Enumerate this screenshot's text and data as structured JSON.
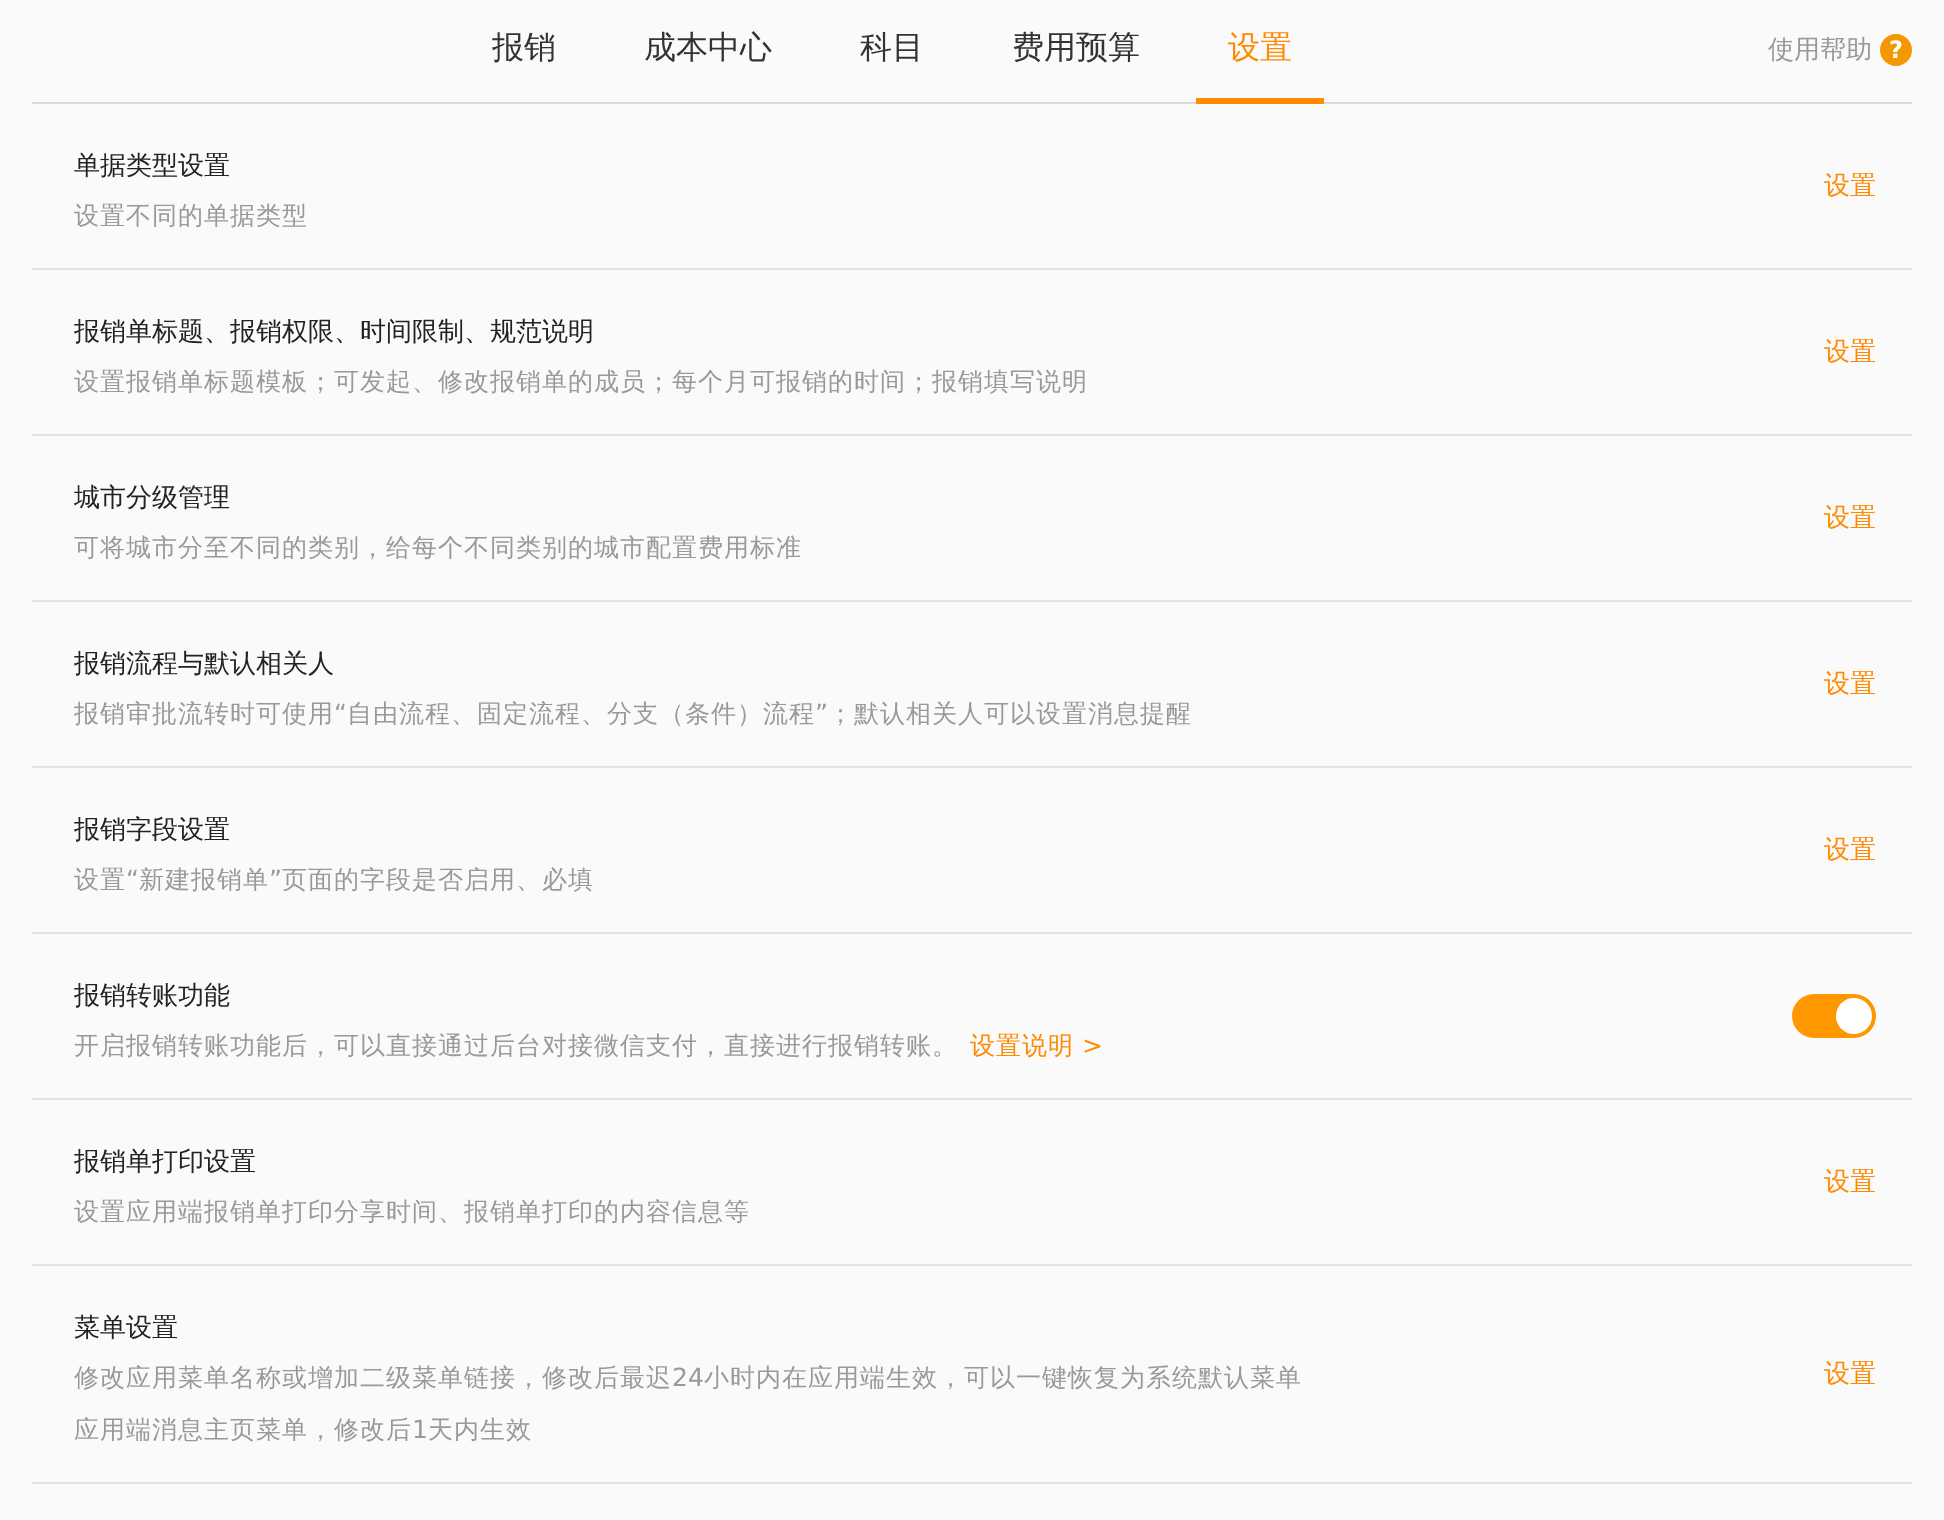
{
  "tabs": [
    {
      "label": "报销",
      "selected": false
    },
    {
      "label": "成本中心",
      "selected": false
    },
    {
      "label": "科目",
      "selected": false
    },
    {
      "label": "费用预算",
      "selected": false
    },
    {
      "label": "设置",
      "selected": true
    }
  ],
  "help": {
    "label": "使用帮助",
    "icon": "?"
  },
  "settings": [
    {
      "kind": "action",
      "title": "单据类型设置",
      "lines": [
        "设置不同的单据类型"
      ],
      "action": "设置"
    },
    {
      "kind": "action",
      "title": "报销单标题、报销权限、时间限制、规范说明",
      "lines": [
        "设置报销单标题模板；可发起、修改报销单的成员；每个月可报销的时间；报销填写说明"
      ],
      "action": "设置"
    },
    {
      "kind": "action",
      "title": "城市分级管理",
      "lines": [
        "可将城市分至不同的类别，给每个不同类别的城市配置费用标准"
      ],
      "action": "设置"
    },
    {
      "kind": "action",
      "title": "报销流程与默认相关人",
      "lines": [
        "报销审批流转时可使用“自由流程、固定流程、分支（条件）流程”；默认相关人可以设置消息提醒"
      ],
      "action": "设置"
    },
    {
      "kind": "action",
      "title": "报销字段设置",
      "lines": [
        "设置“新建报销单”页面的字段是否启用、必填"
      ],
      "action": "设置"
    },
    {
      "kind": "toggle",
      "title": "报销转账功能",
      "lines": [
        "开启报销转账功能后，可以直接通过后台对接微信支付，直接进行报销转账。"
      ],
      "link": "设置说明 >",
      "on": true
    },
    {
      "kind": "action",
      "title": "报销单打印设置",
      "lines": [
        "设置应用端报销单打印分享时间、报销单打印的内容信息等"
      ],
      "action": "设置"
    },
    {
      "kind": "action",
      "title": "菜单设置",
      "lines": [
        "修改应用菜单名称或增加二级菜单链接，修改后最迟24小时内在应用端生效，可以一键恢复为系统默认菜单",
        "应用端消息主页菜单，修改后1天内生效"
      ],
      "action": "设置"
    }
  ]
}
